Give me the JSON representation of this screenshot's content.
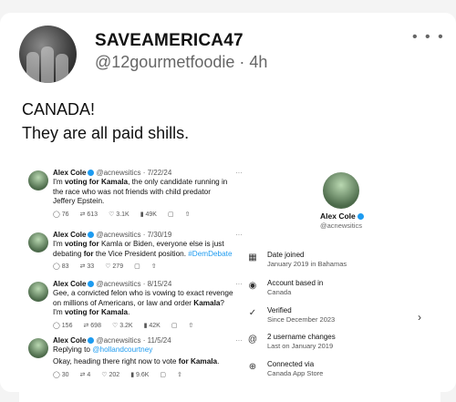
{
  "post": {
    "display_name": "SAVEAMERICA47",
    "handle": "@12gourmetfoodie",
    "separator": "·",
    "time": "4h",
    "more_icon": "ellipsis-icon",
    "text_line1": "CANADA!",
    "text_line2": "They are all paid shills."
  },
  "screenshot": {
    "tweets": [
      {
        "name": "Alex Cole",
        "handle_date": "@acnewsitics · 7/22/24",
        "dots": "···",
        "lines": [
          [
            {
              "b": false,
              "t": "I'm "
            },
            {
              "b": true,
              "t": "voting for Kamala"
            },
            {
              "b": false,
              "t": ", the only candidate running in"
            }
          ],
          [
            {
              "b": false,
              "t": "the race who was not friends with child predator"
            }
          ],
          [
            {
              "b": false,
              "t": "Jeffery Epstein."
            }
          ]
        ],
        "replies": "76",
        "reposts": "613",
        "likes": "3.1K",
        "views": "49K"
      },
      {
        "name": "Alex Cole",
        "handle_date": "@acnewsitics · 7/30/19",
        "dots": "···",
        "lines": [
          [
            {
              "b": false,
              "t": "I'm "
            },
            {
              "b": true,
              "t": "voting for"
            },
            {
              "b": false,
              "t": " Kamla or Biden, everyone else is just"
            }
          ],
          [
            {
              "b": false,
              "t": "debating "
            },
            {
              "b": true,
              "t": "for"
            },
            {
              "b": false,
              "t": " the Vice President position. "
            },
            {
              "tag": true,
              "t": "#DemDebate"
            }
          ]
        ],
        "replies": "83",
        "reposts": "33",
        "likes": "279",
        "views": ""
      },
      {
        "name": "Alex Cole",
        "handle_date": "@acnewsitics · 8/15/24",
        "dots": "···",
        "lines": [
          [
            {
              "b": false,
              "t": "Gee, a convicted felon who is vowing to exact revenge"
            }
          ],
          [
            {
              "b": false,
              "t": "on millions of Americans, or law and order "
            },
            {
              "b": true,
              "t": "Kamala"
            },
            {
              "b": false,
              "t": "?"
            }
          ],
          [
            {
              "b": false,
              "t": "I'm "
            },
            {
              "b": true,
              "t": "voting for Kamala"
            },
            {
              "b": false,
              "t": "."
            }
          ]
        ],
        "replies": "156",
        "reposts": "698",
        "likes": "3.2K",
        "views": "42K"
      },
      {
        "name": "Alex Cole",
        "handle_date": "@acnewsitics · 11/5/24",
        "dots": "···",
        "reply_to": "Replying to",
        "reply_handle": "@hollandcourtney",
        "lines": [
          [
            {
              "b": false,
              "t": "Okay, heading there right now to vote "
            },
            {
              "b": true,
              "t": "for Kamala"
            },
            {
              "b": false,
              "t": "."
            }
          ]
        ],
        "replies": "30",
        "reposts": "4",
        "likes": "202",
        "views": "9.6K"
      }
    ],
    "profile": {
      "name": "Alex Cole",
      "handle": "@acnewsitics",
      "rows": [
        {
          "icon": "calendar-icon",
          "glyph": "▦",
          "label": "Date joined",
          "value": "January 2019 in Bahamas"
        },
        {
          "icon": "location-icon",
          "glyph": "◉",
          "label": "Account based in",
          "value": "Canada"
        },
        {
          "icon": "verified-check-icon",
          "glyph": "✓",
          "label": "Verified",
          "value": "Since December 2023"
        },
        {
          "icon": "at-icon",
          "glyph": "@",
          "label": "2 username changes",
          "value": "Last on January 2019"
        },
        {
          "icon": "globe-icon",
          "glyph": "⊕",
          "label": "Connected via",
          "value": "Canada App Store"
        }
      ],
      "chevron": "›"
    }
  }
}
